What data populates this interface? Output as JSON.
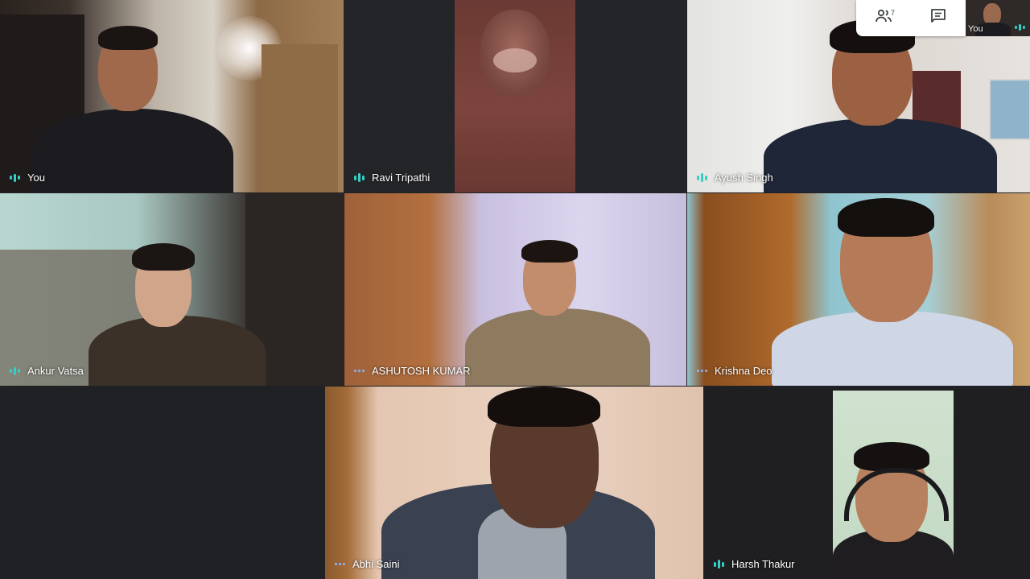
{
  "controls": {
    "people_icon": "people-icon",
    "people_count": "7",
    "chat_icon": "chat-icon"
  },
  "self_view": {
    "label": "You"
  },
  "participants": [
    {
      "name": "You",
      "mic": "speaking"
    },
    {
      "name": "Ravi Tripathi",
      "mic": "speaking"
    },
    {
      "name": "Ayush Singh",
      "mic": "speaking"
    },
    {
      "name": "Ankur Vatsa",
      "mic": "speaking"
    },
    {
      "name": "ASHUTOSH KUMAR",
      "mic": "idle"
    },
    {
      "name": "Krishna Deo",
      "mic": "idle"
    },
    {
      "name": "Abhi Saini",
      "mic": "idle"
    },
    {
      "name": "Harsh Thakur",
      "mic": "speaking"
    }
  ],
  "colors": {
    "background": "#202124",
    "mic_active": "#34d0c6",
    "mic_idle": "#8ab4f8"
  }
}
